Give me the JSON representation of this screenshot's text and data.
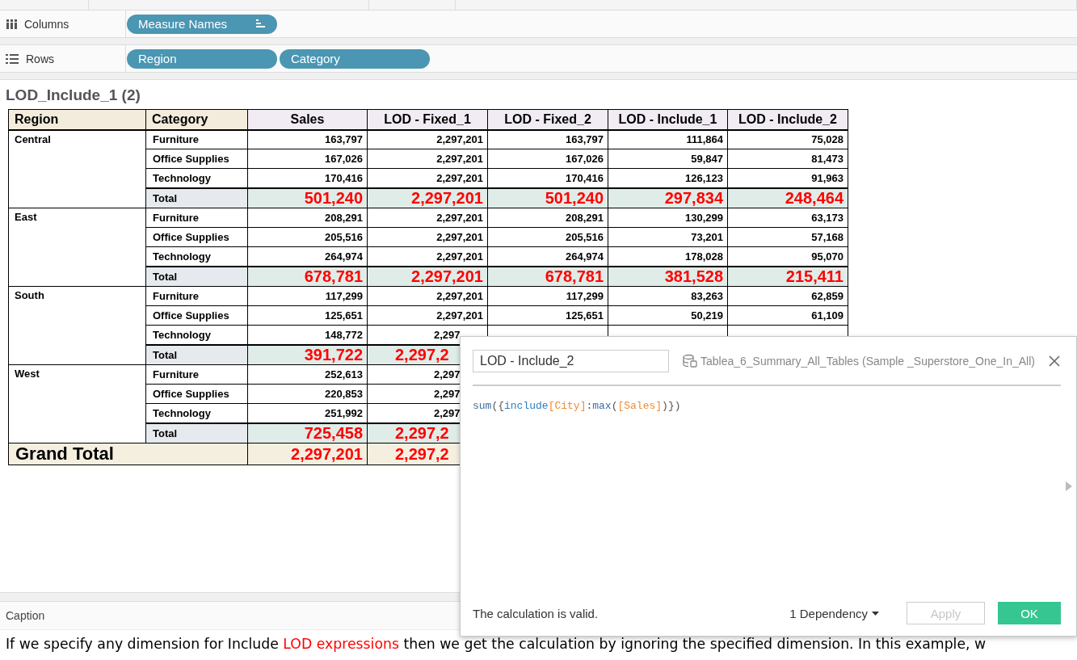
{
  "shelves": [
    {
      "kind": "columns",
      "label": "Columns",
      "pills": [
        {
          "label": "Measure Names",
          "sorted": true
        }
      ]
    },
    {
      "kind": "rows",
      "label": "Rows",
      "pills": [
        {
          "label": "Region",
          "sorted": false
        },
        {
          "label": "Category",
          "sorted": false
        }
      ]
    }
  ],
  "sheet": {
    "title": "LOD_Include_1 (2)"
  },
  "table": {
    "columns": [
      {
        "label": "Region",
        "kind": "dimension"
      },
      {
        "label": "Category",
        "kind": "dimension"
      },
      {
        "label": "Sales",
        "kind": "measure"
      },
      {
        "label": "LOD - Fixed_1",
        "kind": "measure"
      },
      {
        "label": "LOD - Fixed_2",
        "kind": "measure"
      },
      {
        "label": "LOD - Include_1",
        "kind": "measure"
      },
      {
        "label": "LOD - Include_2",
        "kind": "measure"
      }
    ],
    "regions": [
      {
        "name": "Central",
        "rows": [
          {
            "category": "Furniture",
            "values": [
              "163,797",
              "2,297,201",
              "163,797",
              "111,864",
              "75,028"
            ]
          },
          {
            "category": "Office Supplies",
            "values": [
              "167,026",
              "2,297,201",
              "167,026",
              "59,847",
              "81,473"
            ]
          },
          {
            "category": "Technology",
            "values": [
              "170,416",
              "2,297,201",
              "170,416",
              "126,123",
              "91,963"
            ]
          }
        ],
        "total": {
          "label": "Total",
          "values": [
            "501,240",
            "2,297,201",
            "501,240",
            "297,834",
            "248,464"
          ]
        }
      },
      {
        "name": "East",
        "rows": [
          {
            "category": "Furniture",
            "values": [
              "208,291",
              "2,297,201",
              "208,291",
              "130,299",
              "63,173"
            ]
          },
          {
            "category": "Office Supplies",
            "values": [
              "205,516",
              "2,297,201",
              "205,516",
              "73,201",
              "57,168"
            ]
          },
          {
            "category": "Technology",
            "values": [
              "264,974",
              "2,297,201",
              "264,974",
              "178,028",
              "95,070"
            ]
          }
        ],
        "total": {
          "label": "Total",
          "values": [
            "678,781",
            "2,297,201",
            "678,781",
            "381,528",
            "215,411"
          ]
        }
      },
      {
        "name": "South",
        "rows": [
          {
            "category": "Furniture",
            "values": [
              "117,299",
              "2,297,201",
              "117,299",
              "83,263",
              "62,859"
            ]
          },
          {
            "category": "Office Supplies",
            "values": [
              "125,651",
              "2,297,201",
              "125,651",
              "50,219",
              "61,109"
            ]
          },
          {
            "category": "Technology",
            "values": [
              "148,772",
              "2,297"
            ]
          }
        ],
        "total": {
          "label": "Total",
          "values": [
            "391,722",
            "2,297,2"
          ]
        }
      },
      {
        "name": "West",
        "rows": [
          {
            "category": "Furniture",
            "values": [
              "252,613",
              "2,297"
            ]
          },
          {
            "category": "Office Supplies",
            "values": [
              "220,853",
              "2,297"
            ]
          },
          {
            "category": "Technology",
            "values": [
              "251,992",
              "2,297"
            ]
          }
        ],
        "total": {
          "label": "Total",
          "values": [
            "725,458",
            "2,297,2"
          ]
        }
      }
    ],
    "grand_total": {
      "label": "Grand Total",
      "values": [
        "2,297,201",
        "2,297,2"
      ]
    }
  },
  "dialog": {
    "name": "LOD - Include_2",
    "datasource": "Tablea_6_Summary_All_Tables (Sample _Superstore_One_In_All)",
    "formula": [
      {
        "kind": "function",
        "text": "sum"
      },
      {
        "kind": "punct",
        "text": "({"
      },
      {
        "kind": "keyword",
        "text": "include"
      },
      {
        "kind": "field",
        "text": "[City]"
      },
      {
        "kind": "punct",
        "text": ":"
      },
      {
        "kind": "function",
        "text": "max"
      },
      {
        "kind": "punct",
        "text": "("
      },
      {
        "kind": "field",
        "text": "[Sales]"
      },
      {
        "kind": "punct",
        "text": ")})"
      }
    ],
    "status": "The calculation is valid.",
    "dependencies": "1 Dependency",
    "buttons": [
      {
        "label": "Apply",
        "disabled": true
      },
      {
        "label": "OK",
        "disabled": false
      }
    ]
  },
  "caption": {
    "title": "Caption",
    "segments": [
      {
        "text": "If we specify any dimension for Include ",
        "highlight": false
      },
      {
        "text": "LOD expressions",
        "highlight": true
      },
      {
        "text": " then we get the calculation by ignoring the specified dimension. In this example, w",
        "highlight": false
      }
    ]
  }
}
